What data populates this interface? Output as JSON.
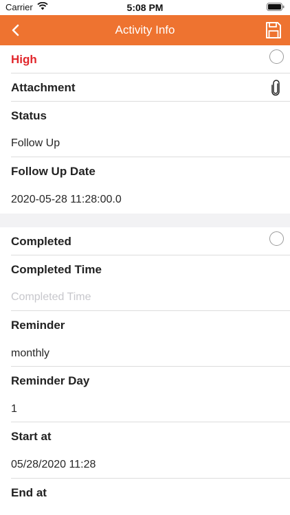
{
  "status_bar": {
    "carrier": "Carrier",
    "time": "5:08 PM"
  },
  "nav": {
    "title": "Activity Info",
    "back_icon": "chevron-left-icon",
    "save_icon": "floppy-disk-icon"
  },
  "rows": {
    "priority": "High",
    "attachment_label": "Attachment",
    "status_label": "Status",
    "status_value": "Follow Up",
    "follow_up_label": "Follow Up Date",
    "follow_up_value": "2020-05-28 11:28:00.0",
    "completed_label": "Completed",
    "completed_time_label": "Completed Time",
    "completed_time_placeholder": "Completed Time",
    "reminder_label": "Reminder",
    "reminder_value": "monthly",
    "reminder_day_label": "Reminder Day",
    "reminder_day_value": "1",
    "start_label": "Start at",
    "start_value": "05/28/2020 11:28",
    "end_label": "End at"
  },
  "colors": {
    "nav_bg": "#ee7330",
    "priority_red": "#e1262b",
    "placeholder": "#c7c7cc"
  }
}
